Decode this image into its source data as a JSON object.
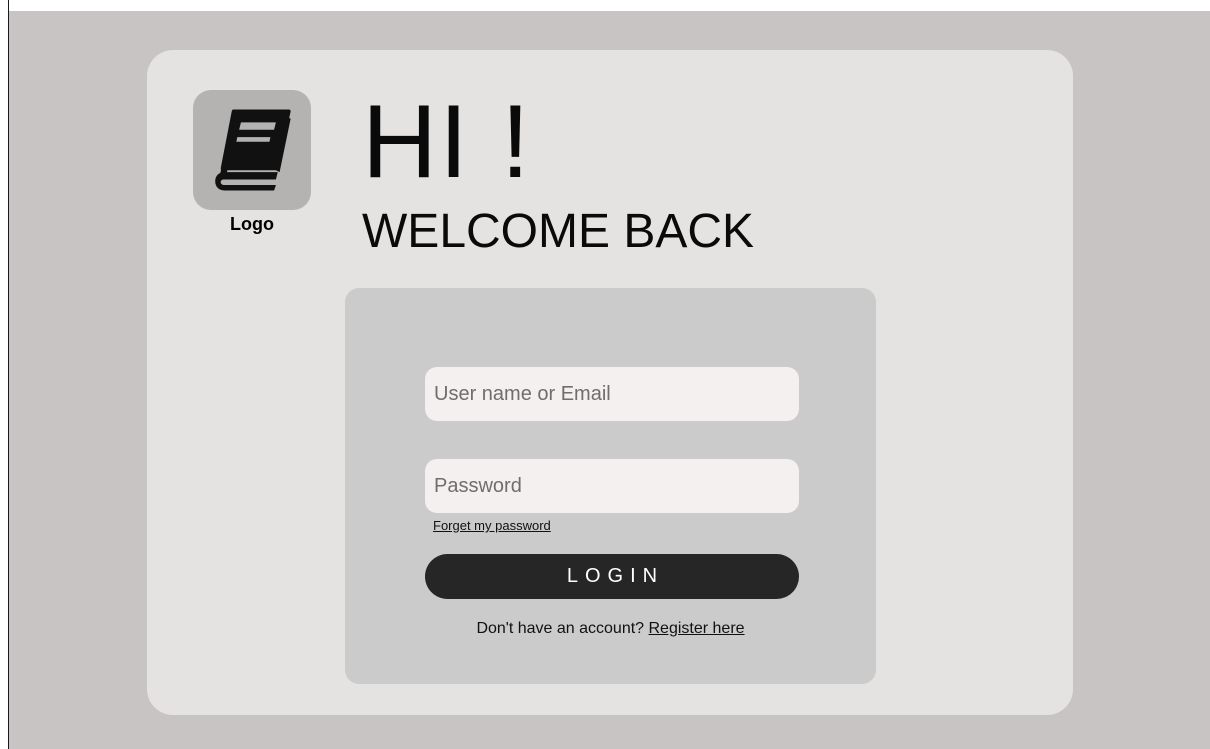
{
  "brand": {
    "logo_label": "Logo",
    "logo_icon": "book-icon"
  },
  "greeting": {
    "title": "HI !",
    "subtitle": "WELCOME BACK"
  },
  "form": {
    "username_placeholder": "User name or Email",
    "username_value": "",
    "password_placeholder": "Password",
    "password_value": "",
    "forgot_label": "Forget my password",
    "login_label": "LOGIN",
    "register_prompt": "Don't have an account? ",
    "register_link": "Register here"
  },
  "colors": {
    "backdrop": "#c8c4c3",
    "card": "#e4e3e2",
    "form_panel": "#cbcbcb",
    "input_bg": "#f3f0ef",
    "button_bg": "#262626",
    "button_text": "#ffffff",
    "logo_bg": "#b5b3b2"
  }
}
